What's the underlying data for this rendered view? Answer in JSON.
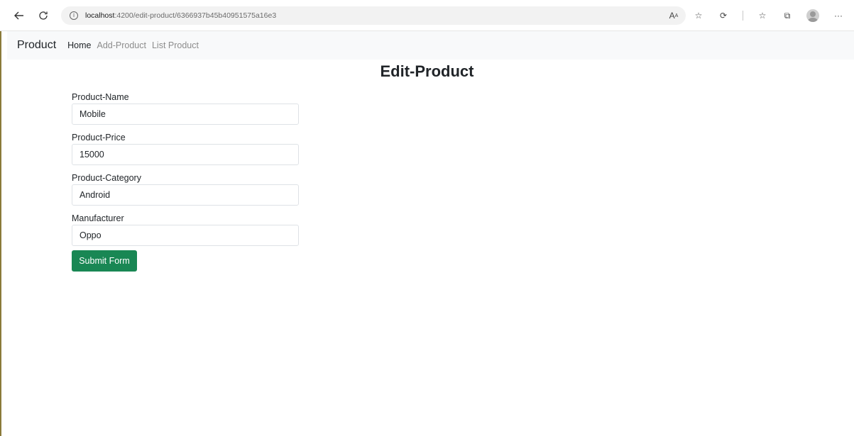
{
  "browser": {
    "url_host": "localhost",
    "url_path": ":4200/edit-product/6366937b45b40951575a16e3"
  },
  "navbar": {
    "brand": "Product",
    "links": [
      "Home",
      "Add-Product",
      "List Product"
    ],
    "active": "Home"
  },
  "page": {
    "title": "Edit-Product"
  },
  "form": {
    "fields": [
      {
        "label": "Product-Name",
        "value": "Mobile"
      },
      {
        "label": "Product-Price",
        "value": "15000"
      },
      {
        "label": "Product-Category",
        "value": "Android"
      },
      {
        "label": "Manufacturer",
        "value": "Oppo"
      }
    ],
    "submit_label": "Submit Form"
  },
  "colors": {
    "submit_bg": "#198754",
    "navbar_bg": "#f8f9fa"
  }
}
